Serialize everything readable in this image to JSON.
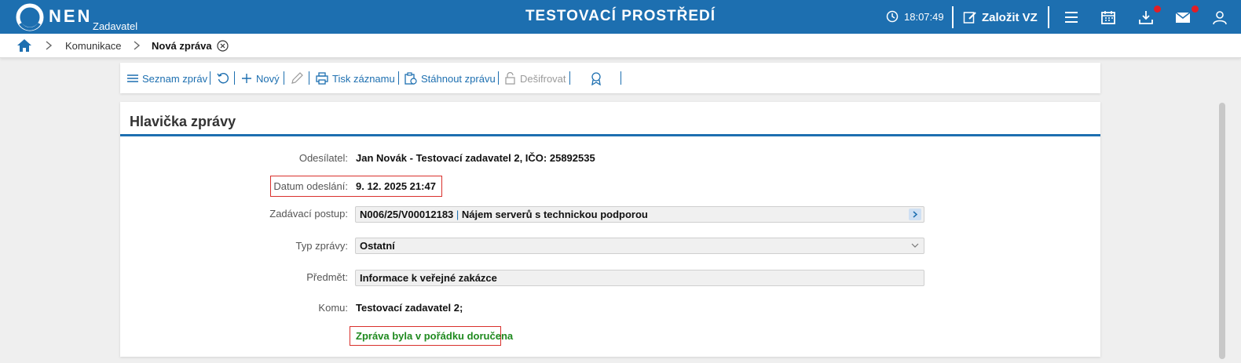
{
  "header": {
    "logo_text": "NEN",
    "logo_sub": "Zadavatel",
    "environment": "TESTOVACÍ PROSTŘEDÍ",
    "time": "18:07:49",
    "create_label": "Založit VZ",
    "icons": [
      "clock-icon",
      "edit-icon",
      "menu-icon",
      "calendar-icon",
      "download-icon",
      "mail-icon",
      "user-icon"
    ]
  },
  "breadcrumb": {
    "items": [
      "Komunikace",
      "Nová zpráva"
    ]
  },
  "toolbar": {
    "list_label": "Seznam zpráv",
    "new_label": "Nový",
    "print_label": "Tisk záznamu",
    "download_label": "Stáhnout zprávu",
    "decrypt_label": "Dešifrovat"
  },
  "panel": {
    "title": "Hlavička zprávy",
    "sender_label": "Odesílatel:",
    "sender_value": "Jan Novák - Testovací zadavatel 2, IČO: 25892535",
    "date_label": "Datum odeslání:",
    "date_value": "9. 12. 2025 21:47",
    "procedure_label": "Zadávací postup:",
    "procedure_code": "N006/25/V00012183",
    "procedure_name": "Nájem serverů s technickou podporou",
    "type_label": "Typ zprávy:",
    "type_value": "Ostatní",
    "subject_label": "Předmět:",
    "subject_value": "Informace k veřejné zakázce",
    "to_label": "Komu:",
    "to_value": "Testovací zadavatel 2;",
    "status": "Zpráva byla v pořádku doručena"
  },
  "colors": {
    "brand": "#1d6fb0",
    "highlight": "#d9302c",
    "success": "#1f8a1f",
    "notification": "#e21e26"
  }
}
